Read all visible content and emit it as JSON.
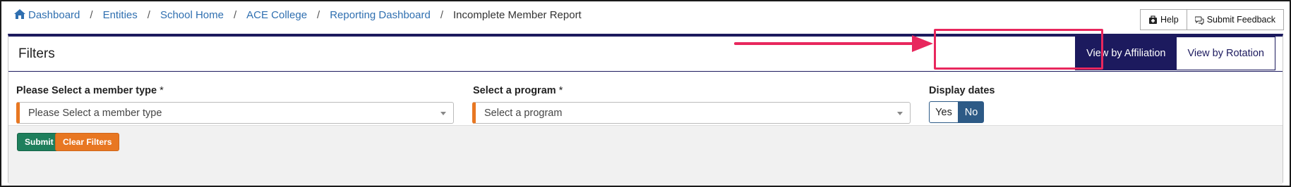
{
  "breadcrumb": {
    "items": [
      "Dashboard",
      "Entities",
      "School Home",
      "ACE College",
      "Reporting Dashboard"
    ],
    "separator": "/",
    "current": "Incomplete Member Report"
  },
  "top_buttons": {
    "help_label": "Help",
    "feedback_label": "Submit Feedback"
  },
  "panel": {
    "title": "Filters",
    "view_toggle": {
      "affiliation_label": "View by Affiliation",
      "rotation_label": "View by Rotation",
      "active": "affiliation"
    }
  },
  "filters": {
    "member_type": {
      "label": "Please Select a member type",
      "required_mark": "*",
      "placeholder": "Please Select a member type"
    },
    "program": {
      "label": "Select a program",
      "required_mark": "*",
      "placeholder": "Select a program"
    },
    "display_dates": {
      "label": "Display dates",
      "yes_label": "Yes",
      "no_label": "No",
      "selected": "No"
    }
  },
  "actions": {
    "submit_label": "Submit",
    "clear_label": "Clear Filters"
  },
  "colors": {
    "navy": "#1c1a5e",
    "link": "#2f6fb0",
    "orange": "#e87722",
    "green": "#1e7f5c",
    "annotation": "#e8275d"
  },
  "icons": [
    "home-icon",
    "help-icon",
    "feedback-icon",
    "caret-down-icon",
    "arrow-annotation"
  ]
}
